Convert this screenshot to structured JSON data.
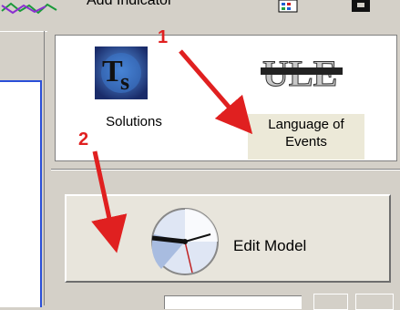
{
  "toolbar": {
    "add_indicator_label": "Add Indicator",
    "indicator_icon": "chart-indicator-icon",
    "grid_icon": "grid-icon",
    "save_icon": "save-icon"
  },
  "tools": {
    "solutions_label": "Solutions",
    "language_of_events_label_line1": "Language of",
    "language_of_events_label_line2": "Events",
    "solutions_icon": "ts-logo-icon",
    "loe_icon": "ule-icon"
  },
  "edit_model": {
    "label": "Edit Model",
    "icon": "clock-icon"
  },
  "annotations": {
    "step1": "1",
    "step2": "2",
    "arrow_color": "#e02020"
  }
}
